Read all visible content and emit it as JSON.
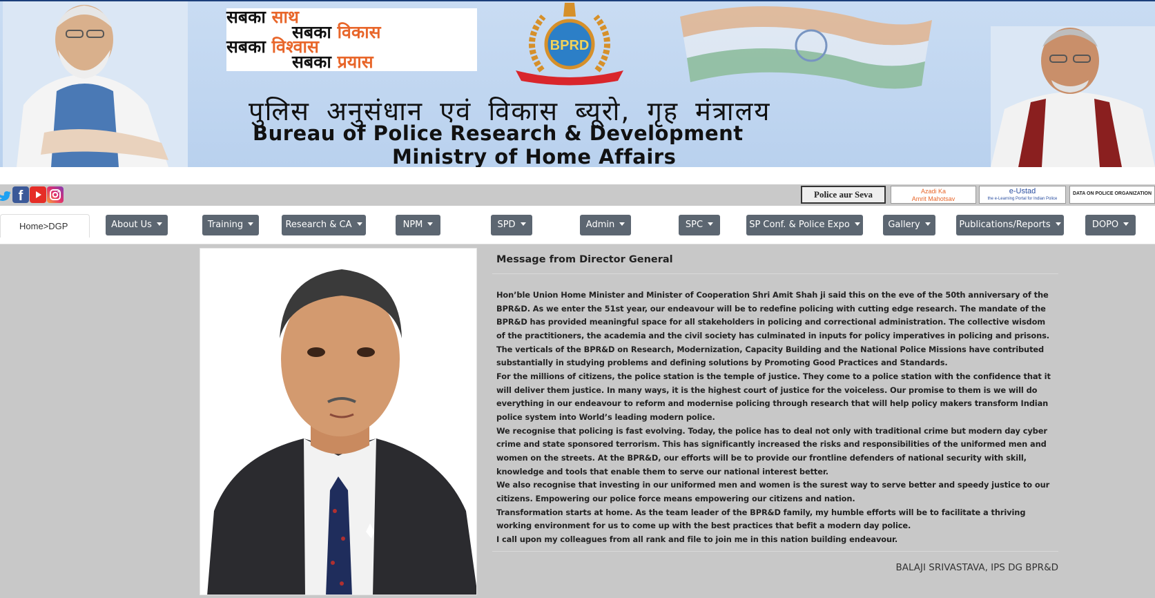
{
  "banner": {
    "slogan": [
      {
        "plain": "सबका ",
        "accent": "साथ"
      },
      {
        "plain": "सबका ",
        "accent": "विकास"
      },
      {
        "plain": "सबका ",
        "accent": "विश्वास"
      },
      {
        "plain": "सबका ",
        "accent": "प्रयास"
      }
    ],
    "emblem_text": "BPRD",
    "hindi_title": "पुलिस अनुसंधान एवं विकास ब्यूरो, गृह मंत्रालय",
    "english_title_line1": "Bureau of Police Research & Development",
    "english_title_line2": "Ministry of Home Affairs",
    "colors": {
      "banner_bg": "#c9dcf3",
      "accent": "#e8662a",
      "navy": "#1b3f7a"
    }
  },
  "social": {
    "icons": [
      "twitter-icon",
      "facebook-icon",
      "youtube-icon",
      "instagram-icon"
    ],
    "fb_glyph": "f"
  },
  "partners": {
    "seva": "Police aur Seva",
    "azadi_1": "Azadi Ka",
    "azadi_2": "Amrit Mahotsav",
    "eustad": "e-Ustad",
    "eustad_sub": "the e-Learning Portal for Indian Police",
    "dopo": "DATA ON POLICE ORGANIZATION"
  },
  "nav": {
    "breadcrumb": "Home>DGP",
    "items": [
      {
        "label": "About Us"
      },
      {
        "label": "Training"
      },
      {
        "label": "Research & CA"
      },
      {
        "label": "NPM"
      },
      {
        "label": "SPD"
      },
      {
        "label": "Admin"
      },
      {
        "label": "SPC"
      },
      {
        "label": "SP Conf. & Police Expo"
      },
      {
        "label": "Gallery"
      },
      {
        "label": "Publications/Reports"
      },
      {
        "label": "DOPO"
      }
    ],
    "button_color": "#5c6671"
  },
  "message": {
    "title": "Message from Director General",
    "paragraphs": [
      "Hon’ble Union Home Minister and Minister of Cooperation Shri Amit Shah ji said this on the eve of the 50th anniversary of the BPR&D. As we enter the 51st year, our endeavour will be to redefine policing with cutting edge research. The mandate of the BPR&D has provided meaningful space for all stakeholders in policing and correctional administration. The collective wisdom of the practitioners, the academia and the civil society has culminated in inputs for policy imperatives in policing and prisons. The verticals of the BPR&D on Research, Modernization, Capacity Building and the National Police Missions have contributed substantially in studying problems and defining solutions by Promoting Good Practices and Standards.",
      "For the millions of citizens, the police station is the temple of justice. They come to a police station with the confidence that it will deliver them justice. In many ways, it is the highest court of justice for the voiceless. Our promise to them is we will do everything in our endeavour to reform and modernise policing through research that will help policy makers transform Indian police system into World’s leading modern police.",
      "We recognise that policing is fast evolving. Today, the police has to deal not only with traditional crime but modern day cyber crime and state sponsored terrorism. This has significantly increased the risks and responsibilities of the uniformed men and women on the streets. At the BPR&D, our efforts will be to provide our frontline defenders of national security with skill, knowledge and tools that enable them to serve our national interest better.",
      "We also recognise that investing in our uniformed men and women is the surest way to serve better and speedy justice to our citizens. Empowering our police force means empowering our citizens and nation.",
      "Transformation starts at home. As the team leader of the BPR&D family, my humble efforts will be to facilitate a thriving working environment for us to come up with the best practices that befit a modern day police.",
      "I call upon my colleagues from all rank and file to join me in this nation building endeavour."
    ],
    "signature": "BALAJI SRIVASTAVA, IPS DG BPR&D"
  }
}
